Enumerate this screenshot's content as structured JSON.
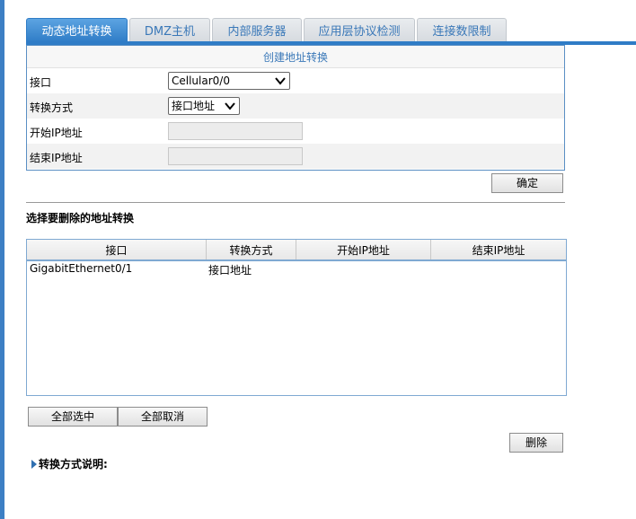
{
  "tabs": [
    {
      "label": "动态地址转换",
      "active": true
    },
    {
      "label": "DMZ主机",
      "active": false
    },
    {
      "label": "内部服务器",
      "active": false
    },
    {
      "label": "应用层协议检测",
      "active": false
    },
    {
      "label": "连接数限制",
      "active": false
    }
  ],
  "create_form": {
    "title": "创建地址转换",
    "interface_label": "接口",
    "interface_value": "Cellular0/0",
    "mode_label": "转换方式",
    "mode_value": "接口地址",
    "start_ip_label": "开始IP地址",
    "start_ip_value": "",
    "end_ip_label": "结束IP地址",
    "end_ip_value": "",
    "confirm_label": "确定"
  },
  "delete_section": {
    "title": "选择要删除的地址转换",
    "columns": [
      "接口",
      "转换方式",
      "开始IP地址",
      "结束IP地址"
    ],
    "rows": [
      {
        "interface": "GigabitEthernet0/1",
        "mode": "接口地址",
        "start_ip": "",
        "end_ip": ""
      }
    ],
    "select_all_label": "全部选中",
    "deselect_all_label": "全部取消",
    "delete_label": "删除"
  },
  "explanation_label": "转换方式说明:",
  "colors": {
    "accent": "#2f7cc6",
    "tab_text": "#3a78b8",
    "border": "#5a8fc4"
  },
  "icons": {
    "expand": "triangle-right-icon",
    "dropdown": "chevron-down-icon"
  }
}
